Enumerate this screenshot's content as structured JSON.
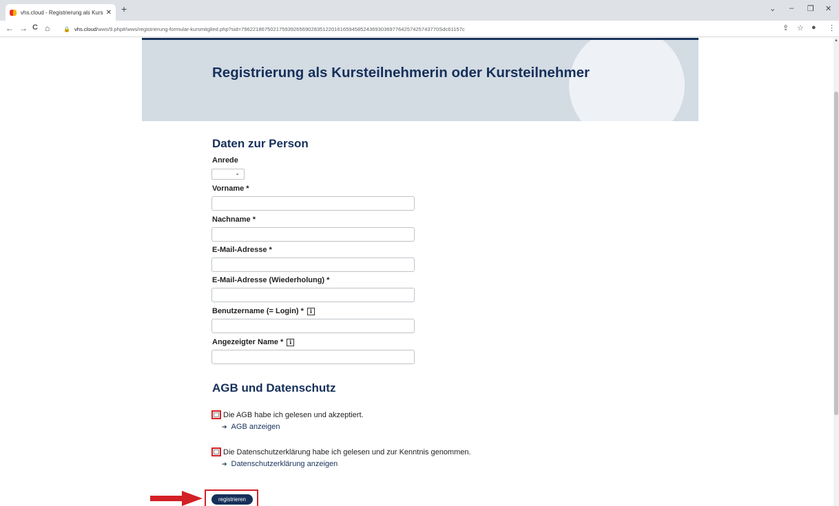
{
  "browser": {
    "tab_title": "vhs.cloud - Registrierung als Kurs",
    "tab_close": "✕",
    "new_tab": "+",
    "window_controls": [
      "⌄",
      "–",
      "❐",
      "✕"
    ],
    "url_host": "vhs.cloud",
    "url_path": "/wws/9.php#/wws/registrierung-formular-kursmitglied.php?sid=79622186750217593926569028351220161659458524369303697764257425743770Sdc61157c",
    "nav_back": "←",
    "nav_forward": "→",
    "nav_reload": "C",
    "nav_home": "⌂"
  },
  "header": {
    "title": "Registrierung als Kursteilnehmerin oder Kursteilnehmer"
  },
  "personal": {
    "section_title": "Daten zur Person",
    "salutation_label": "Anrede",
    "salutation_value": "",
    "fields": [
      {
        "label": "Vorname *",
        "value": ""
      },
      {
        "label": "Nachname *",
        "value": ""
      },
      {
        "label": "E-Mail-Adresse *",
        "value": ""
      },
      {
        "label": "E-Mail-Adresse (Wiederholung) *",
        "value": ""
      },
      {
        "label": "Benutzername (= Login) *",
        "value": ""
      },
      {
        "label": "Angezeigter Name *",
        "value": ""
      }
    ],
    "info_glyph": "i"
  },
  "terms": {
    "section_title": "AGB und Datenschutz",
    "agb_text": "Die AGB habe ich gelesen und akzeptiert.",
    "agb_link": "AGB anzeigen",
    "privacy_text": "Die Datenschutzerklärung habe ich gelesen und zur Kenntnis genommen.",
    "privacy_link": "Datenschutzerklärung anzeigen",
    "arrow_glyph": "➔"
  },
  "submit": {
    "label": "registrieren"
  },
  "colors": {
    "brand_navy": "#16305a",
    "header_bg": "#d3dbe3",
    "highlight_red": "#d32025"
  }
}
